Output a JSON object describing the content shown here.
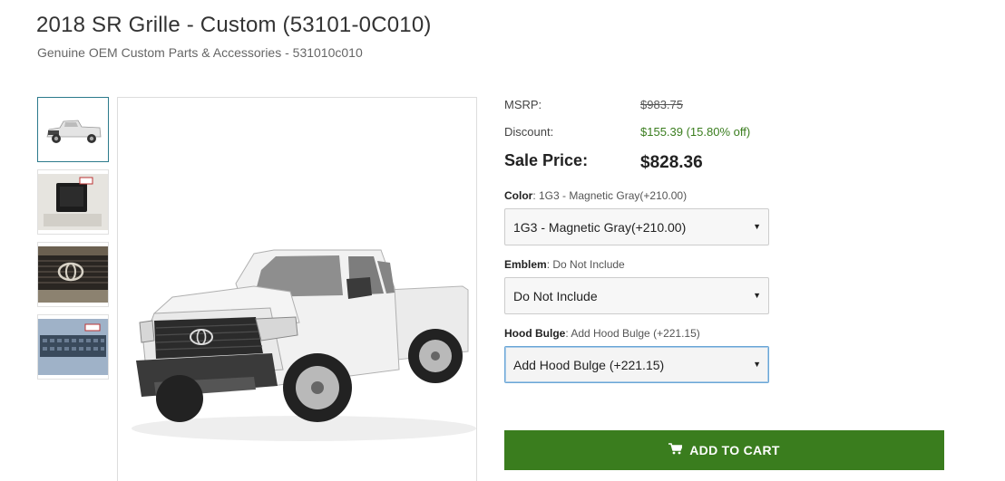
{
  "product": {
    "title": "2018 SR Grille - Custom (53101-0C010)",
    "subtitle": "Genuine OEM Custom Parts & Accessories - 531010c010"
  },
  "gallery": {
    "thumbnails": [
      "truck-white-thumbnail",
      "grille-package-thumbnail",
      "grille-emblem-closeup-thumbnail",
      "grille-install-thumbnail"
    ],
    "active_index": 0
  },
  "pricing": {
    "msrp_label": "MSRP:",
    "msrp_value": "$983.75",
    "discount_label": "Discount:",
    "discount_value": "$155.39 (15.80% off)",
    "sale_label": "Sale Price:",
    "sale_value": "$828.36"
  },
  "options": {
    "color": {
      "label": "Color",
      "current": ": 1G3 - Magnetic Gray(+210.00)",
      "selected": "1G3 - Magnetic Gray(+210.00)"
    },
    "emblem": {
      "label": "Emblem",
      "current": ": Do Not Include",
      "selected": "Do Not Include"
    },
    "hood_bulge": {
      "label": "Hood Bulge",
      "current": ": Add Hood Bulge (+221.15)",
      "selected": "Add Hood Bulge (+221.15)"
    }
  },
  "cart": {
    "button_label": "ADD TO CART"
  },
  "colors": {
    "accent_green": "#3a7d1e",
    "focus_blue": "#6aa6d6"
  }
}
